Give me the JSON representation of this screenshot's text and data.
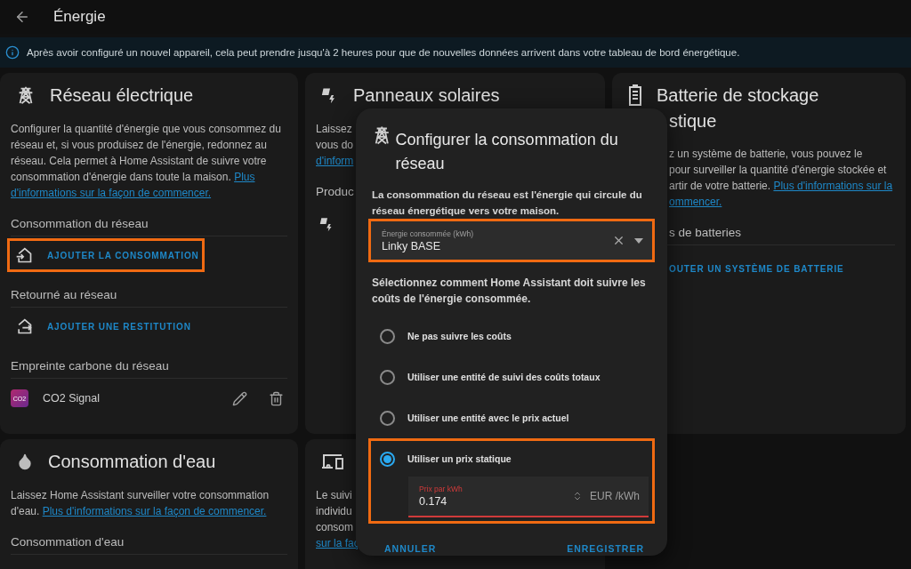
{
  "header": {
    "title": "Énergie"
  },
  "banner": {
    "text": "Après avoir configuré un nouvel appareil, cela peut prendre jusqu'à 2 heures pour que de nouvelles données arrivent dans votre tableau de bord énergétique."
  },
  "grid_card": {
    "title": "Réseau électrique",
    "description": "Configurer la quantité d'énergie que vous consommez du réseau et, si vous produisez de l'énergie, redonnez au réseau. Cela permet à Home Assistant de suivre votre consommation d'énergie dans toute la maison.",
    "link": "Plus d'informations sur la façon de commencer.",
    "sections": [
      {
        "label": "Consommation du réseau",
        "kind": "import",
        "action": "AJOUTER LA CONSOMMATION",
        "highlighted": true
      },
      {
        "label": "Retourné au réseau",
        "kind": "export",
        "action": "AJOUTER UNE RESTITUTION",
        "highlighted": false
      },
      {
        "label": "Empreinte carbone du réseau",
        "kind": "entity",
        "entity": "CO2 Signal",
        "logo_text": "CO2"
      }
    ]
  },
  "solar_card": {
    "title": "Panneaux solaires",
    "lines": [
      "Laissez",
      "vous do"
    ],
    "link": "d'inform",
    "section_label": "Produc"
  },
  "battery_card": {
    "title_lines": [
      "Batterie de stockage",
      "stique"
    ],
    "lines": [
      "z un système de batterie, vous pouvez le",
      "pour surveiller la quantité d'énergie stockée et",
      "artir de votre batterie."
    ],
    "link_lines": [
      "Plus d'informations sur la",
      "ommencer."
    ],
    "section_label": "s de batteries",
    "action": "OUTER UN SYSTÈME DE BATTERIE"
  },
  "water_card": {
    "title": "Consommation d'eau",
    "description": "Laissez Home Assistant surveiller votre consommation d'eau.",
    "link": "Plus d'informations sur la façon de commencer.",
    "section_label": "Consommation d'eau"
  },
  "devices_card": {
    "lines": [
      "Le suivi",
      "individu",
      "consom"
    ],
    "link": "sur la faç"
  },
  "dialog": {
    "title": "Configurer la consommation du réseau",
    "description": "La consommation du réseau est l'énergie qui circule du réseau énergétique vers votre maison.",
    "entity_field": {
      "label": "Énergie consommée (kWh)",
      "value": "Linky BASE",
      "highlighted": true
    },
    "cost_prompt": "Sélectionnez comment Home Assistant doit suivre les coûts de l'énergie consommée.",
    "options": [
      {
        "label": "Ne pas suivre les coûts",
        "selected": false,
        "highlighted": false
      },
      {
        "label": "Utiliser une entité de suivi des coûts totaux",
        "selected": false,
        "highlighted": false
      },
      {
        "label": "Utiliser une entité avec le prix actuel",
        "selected": false,
        "highlighted": false
      },
      {
        "label": "Utiliser un prix statique",
        "selected": true,
        "highlighted": true
      }
    ],
    "price_field": {
      "label": "Prix par kWh",
      "value": "0.174",
      "unit": "EUR /kWh"
    },
    "buttons": [
      "ANNULER",
      "ENREGISTRER"
    ]
  }
}
